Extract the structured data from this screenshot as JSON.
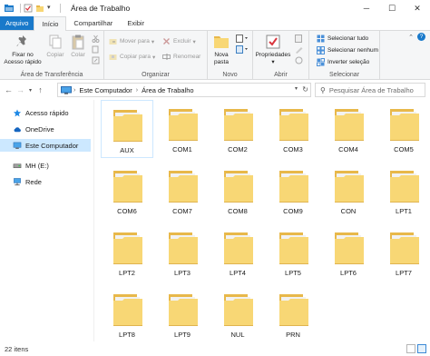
{
  "window": {
    "title": "Área de Trabalho",
    "minimize_glyph": "─",
    "maximize_glyph": "☐",
    "close_glyph": "✕"
  },
  "ribbon_tabs": [
    "Arquivo",
    "Início",
    "Compartilhar",
    "Exibir"
  ],
  "ribbon": {
    "clipboard": {
      "label": "Área de Transferência",
      "pin": "Fixar no Acesso rápido",
      "copy": "Copiar",
      "paste": "Colar"
    },
    "organize": {
      "label": "Organizar",
      "move_to": "Mover para",
      "copy_to": "Copiar para",
      "delete": "Excluir",
      "rename": "Renomear"
    },
    "new": {
      "label": "Novo",
      "new_folder": "Nova pasta"
    },
    "open": {
      "label": "Abrir",
      "properties": "Propriedades"
    },
    "select": {
      "label": "Selecionar",
      "select_all": "Selecionar tudo",
      "select_none": "Selecionar nenhum",
      "invert": "Inverter seleção"
    }
  },
  "address": {
    "crumbs": [
      "Este Computador",
      "Área de Trabalho"
    ],
    "search_placeholder": "Pesquisar Área de Trabalho"
  },
  "nav_pane": [
    {
      "label": "Acesso rápido",
      "icon": "star-icon"
    },
    {
      "label": "OneDrive",
      "icon": "cloud-icon"
    },
    {
      "label": "Este Computador",
      "icon": "computer-icon",
      "selected": true
    },
    {
      "label": "MH (E:)",
      "icon": "drive-icon"
    },
    {
      "label": "Rede",
      "icon": "network-icon"
    }
  ],
  "folders": [
    "AUX",
    "COM1",
    "COM2",
    "COM3",
    "COM4",
    "COM5",
    "COM6",
    "COM7",
    "COM8",
    "COM9",
    "CON",
    "LPT1",
    "LPT2",
    "LPT3",
    "LPT4",
    "LPT5",
    "LPT6",
    "LPT7",
    "LPT8",
    "LPT9",
    "NUL",
    "PRN"
  ],
  "status": {
    "item_count": "22 itens"
  },
  "colors": {
    "accent": "#1979ca",
    "folder_body": "#f8d775",
    "folder_back": "#e8b84a",
    "selection": "#cce8ff"
  }
}
